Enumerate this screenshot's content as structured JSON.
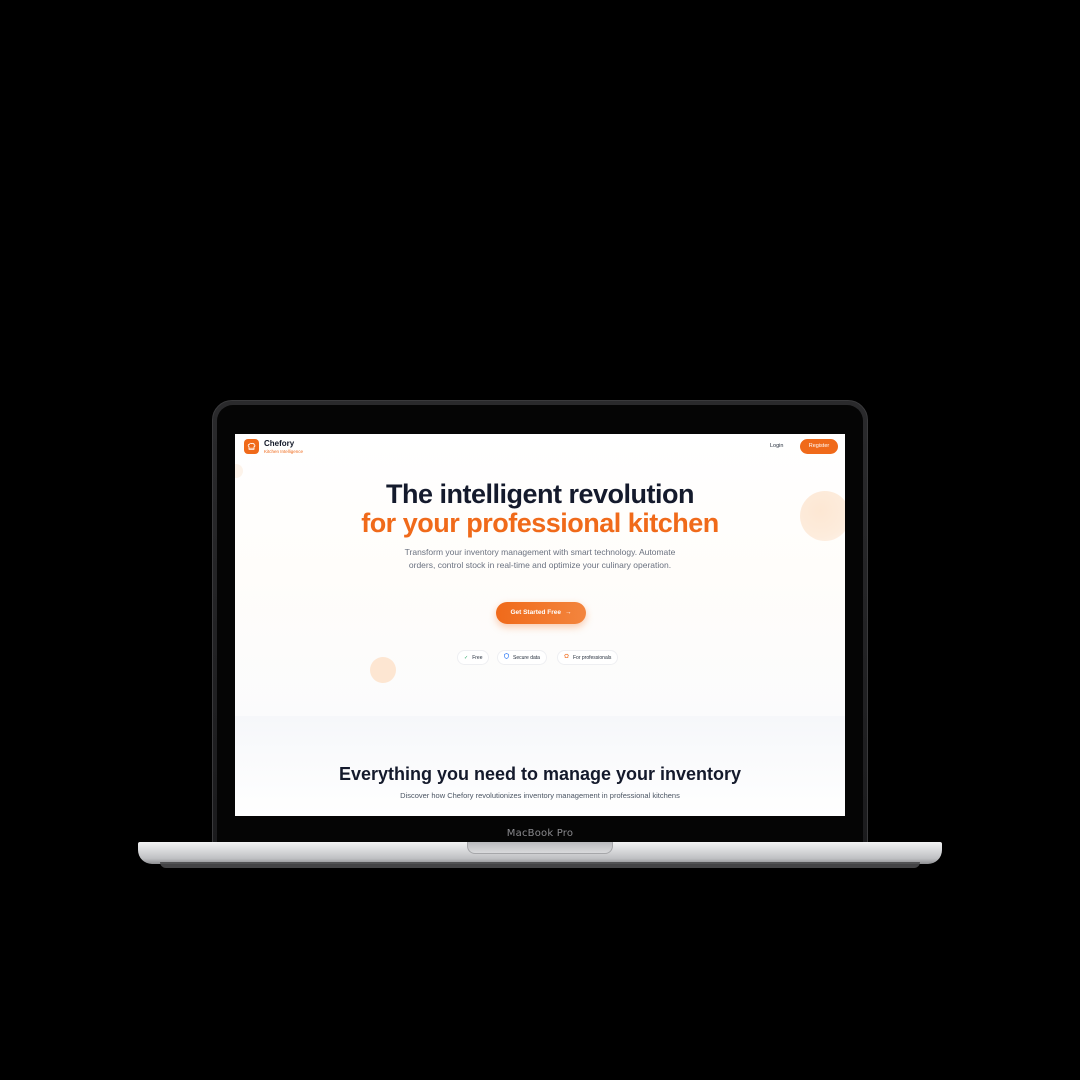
{
  "device": {
    "model_label": "MacBook Pro"
  },
  "nav": {
    "brand_name": "Chefory",
    "brand_tagline": "Kitchen Intelligence",
    "logo_icon": "chef-hat-icon",
    "login_label": "Login",
    "register_label": "Register"
  },
  "hero": {
    "title_line1": "The intelligent revolution",
    "title_line2": "for your professional kitchen",
    "description": "Transform your inventory management with smart technology. Automate orders, control stock in real-time and optimize your culinary operation.",
    "cta_label": "Get Started Free",
    "cta_arrow": "→",
    "badges": [
      {
        "label": "Free",
        "icon": "check-icon"
      },
      {
        "label": "Secure data",
        "icon": "shield-icon"
      },
      {
        "label": "For professionals",
        "icon": "chef-hat-icon"
      }
    ]
  },
  "features": {
    "title": "Everything you need to manage your inventory",
    "description": "Discover how Chefory revolutionizes inventory management in professional kitchens"
  },
  "colors": {
    "accent": "#f06a1a",
    "heading": "#141a2c",
    "body_text": "#6b7280"
  }
}
